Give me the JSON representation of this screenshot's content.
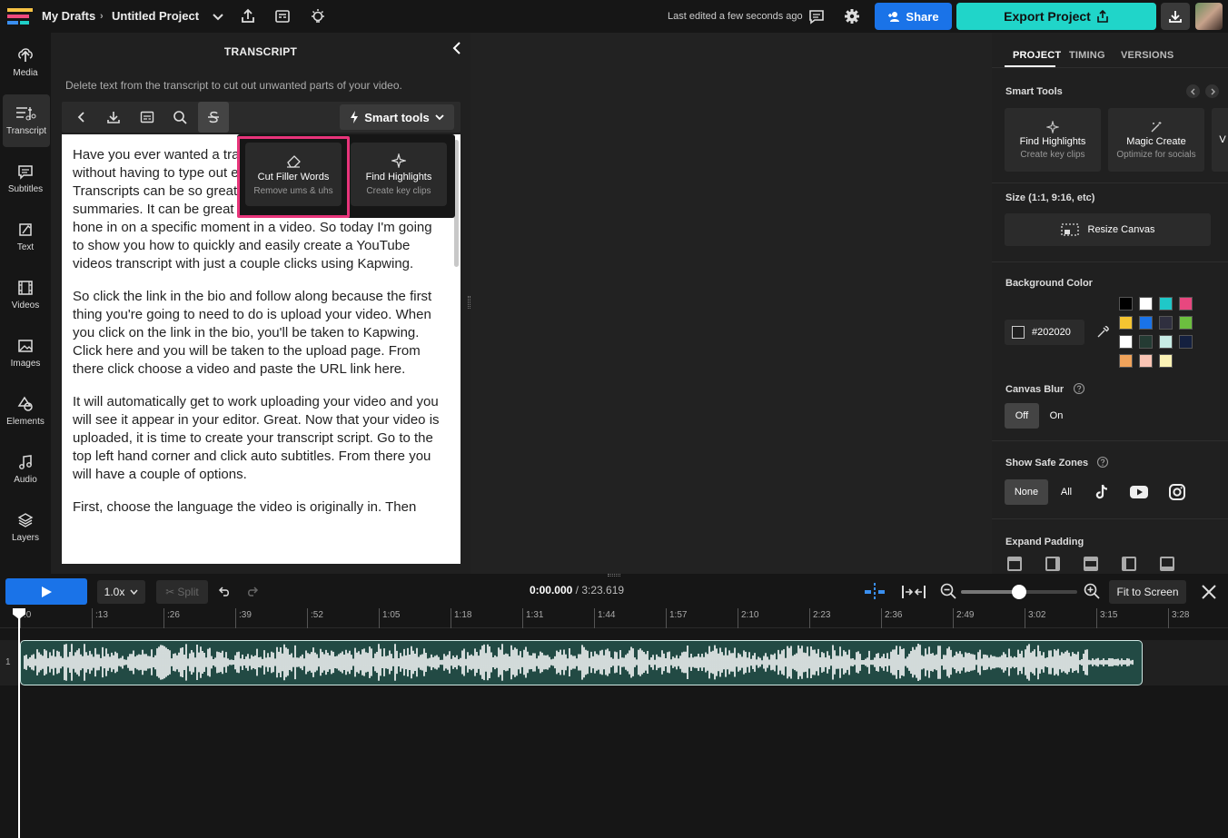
{
  "topbar": {
    "breadcrumb_root": "My Drafts",
    "project_name": "Untitled Project",
    "last_edited": "Last edited a few seconds ago",
    "share_label": "Share",
    "export_label": "Export Project"
  },
  "rail": {
    "items": [
      {
        "label": "Media",
        "icon": "upload-icon"
      },
      {
        "label": "Transcript",
        "icon": "transcript-icon"
      },
      {
        "label": "Subtitles",
        "icon": "subtitles-icon"
      },
      {
        "label": "Text",
        "icon": "text-icon"
      },
      {
        "label": "Videos",
        "icon": "film-icon"
      },
      {
        "label": "Images",
        "icon": "image-icon"
      },
      {
        "label": "Elements",
        "icon": "shapes-icon"
      },
      {
        "label": "Audio",
        "icon": "music-icon"
      },
      {
        "label": "Layers",
        "icon": "layers-icon"
      }
    ]
  },
  "transcript": {
    "title": "TRANSCRIPT",
    "hint": "Delete text from the transcript to cut out unwanted parts of your video.",
    "smart_tools_label": "Smart tools",
    "paragraphs": [
      "Have you ever wanted a transcript of a YouTube video without having to type out every single word yourself? Transcripts can be so great for notes, quotes and summaries. It can be great for SEO and it can help you to hone in on a specific moment in a video. So today I'm going to show you how to quickly and easily create a YouTube videos transcript with just a couple clicks using Kapwing.",
      "So click the link in the bio and follow along because the first thing you're going to need to do is upload your video. When you click on the link in the bio, you'll be taken to Kapwing. Click here and you will be taken to the upload page. From there click choose a video and paste the URL link here.",
      "It will automatically get to work uploading your video and you will see it appear in your editor. Great. Now that your video is uploaded, it is time to create your transcript script. Go to the top left hand corner and click auto subtitles. From there you will have a couple of options.",
      "First, choose the language the video is originally in. Then"
    ],
    "dropdown": [
      {
        "title": "Cut Filler Words",
        "subtitle": "Remove ums & uhs"
      },
      {
        "title": "Find Highlights",
        "subtitle": "Create key clips"
      }
    ]
  },
  "right_panel": {
    "tabs": [
      "PROJECT",
      "TIMING",
      "VERSIONS"
    ],
    "smart_tools_label": "Smart Tools",
    "smart_tools": [
      {
        "title": "Find Highlights",
        "subtitle": "Create key clips"
      },
      {
        "title": "Magic Create",
        "subtitle": "Optimize for socials"
      },
      {
        "title": "V",
        "subtitle": ""
      }
    ],
    "size_label": "Size (1:1, 9:16, etc)",
    "resize_label": "Resize Canvas",
    "bg_color_label": "Background Color",
    "bg_color_value": "#202020",
    "swatches": [
      "#000000",
      "#ffffff",
      "#1fc8c8",
      "#e8477f",
      "#f5c431",
      "#1a73e8",
      "#2f2f3f",
      "#6cbf3f",
      "#ffffff",
      "#243b33",
      "#c8ece5",
      "#14203f",
      "#f0a35b",
      "#f9c4b4",
      "#fbf2b5"
    ],
    "canvas_blur_label": "Canvas Blur",
    "blur_options": [
      "Off",
      "On"
    ],
    "safe_zones_label": "Show Safe Zones",
    "safe_zone_options": [
      "None",
      "All"
    ],
    "expand_padding_label": "Expand Padding"
  },
  "timeline": {
    "speed": "1.0x",
    "split_label": "Split",
    "current_time": "0:00.000",
    "total_time": "/ 3:23.619",
    "fit_label": "Fit to Screen",
    "zoom_level": 0.5,
    "track_number": "1",
    "ticks": [
      ":0",
      ":13",
      ":26",
      ":39",
      ":52",
      "1:05",
      "1:18",
      "1:31",
      "1:44",
      "1:57",
      "2:10",
      "2:23",
      "2:36",
      "2:49",
      "3:02",
      "3:15",
      "3:28"
    ]
  }
}
